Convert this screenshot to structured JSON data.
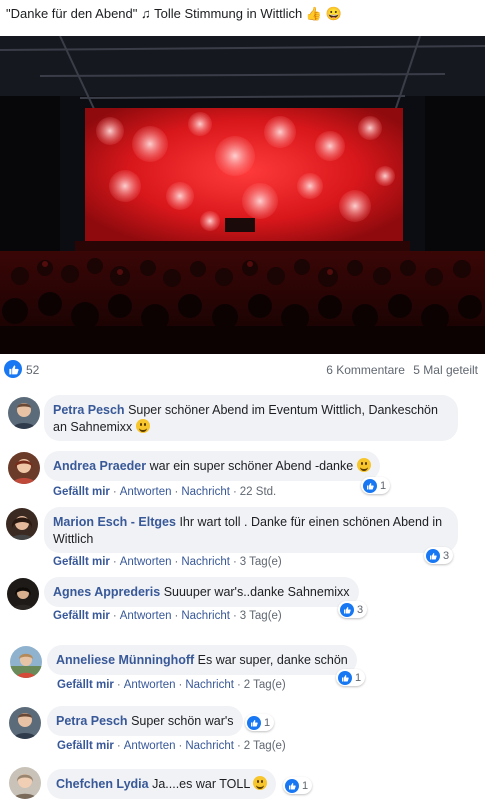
{
  "post": {
    "text": "\"Danke für den Abend\" ♫ Tolle Stimmung in Wittlich 👍 😀"
  },
  "stats": {
    "likes": "52",
    "comments": "6 Kommentare",
    "shares": "5 Mal geteilt"
  },
  "actions": {
    "like": "Gefällt mir",
    "reply": "Antworten",
    "message": "Nachricht",
    "sep": "·"
  },
  "comments": [
    {
      "author": "Petra Pesch",
      "text": "Super schöner Abend im Eventum Wittlich, Dankeschön an Sahnemixx",
      "time": "",
      "reactions": ""
    },
    {
      "author": "Andrea Praeder",
      "text": "war ein super schöner Abend -danke",
      "time": "22 Std.",
      "reactions": "1"
    },
    {
      "author": "Marion Esch - Eltges",
      "text": "Ihr wart toll . Danke für einen schönen Abend in Wittlich",
      "time": "3 Tag(e)",
      "reactions": "3"
    },
    {
      "author": "Agnes Apprederis",
      "text": "Suuuper war's..danke Sahnemixx",
      "time": "3 Tag(e)",
      "reactions": "3"
    },
    {
      "author": "Anneliese Münninghoff",
      "text": "Es war super, danke schön",
      "time": "2 Tag(e)",
      "reactions": "1"
    },
    {
      "author": "Petra Pesch",
      "text": "Super schön war's",
      "time": "2 Tag(e)",
      "reactions": "1"
    },
    {
      "author": "Chefchen Lydia",
      "text": "Ja....es war TOLL",
      "time": "",
      "reactions": "1"
    }
  ]
}
